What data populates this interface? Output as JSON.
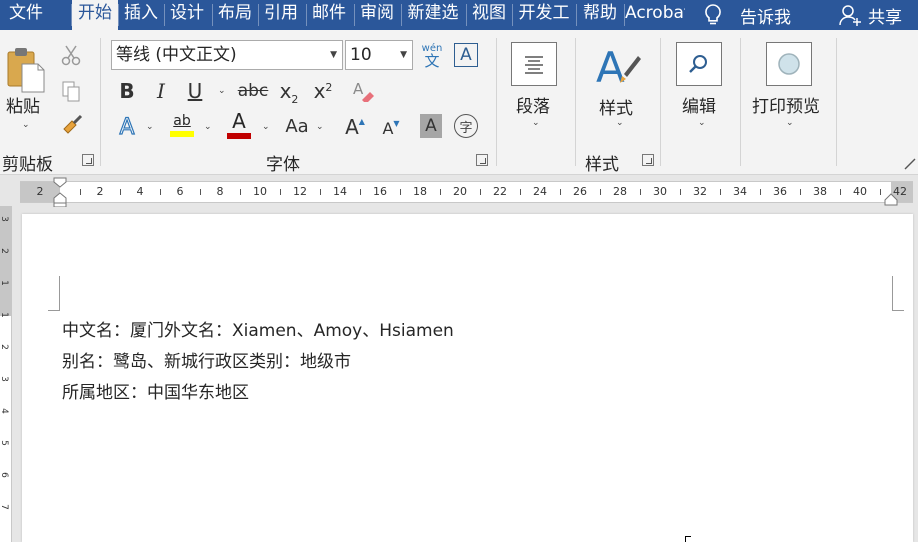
{
  "tabs": [
    "文件",
    "开始",
    "插入",
    "设计",
    "布局",
    "引用",
    "邮件",
    "审阅",
    "新建选",
    "视图",
    "开发工",
    "帮助",
    "Acrobat"
  ],
  "active_tab": "开始",
  "tell_me": "告诉我",
  "share": "共享",
  "clipboard": {
    "paste_label": "粘贴",
    "group_label": "剪贴板"
  },
  "font": {
    "name_value": "等线 (中文正文)",
    "size_value": "10",
    "group_label": "字体",
    "phonetic_top": "wén",
    "phonetic_bottom": "文",
    "border_char": "A",
    "bold": "B",
    "italic": "I",
    "underline": "U",
    "strikethrough": "abc",
    "subscript": "x",
    "subscript_mark": "2",
    "superscript": "x",
    "superscript_mark": "2",
    "change_case": "Aa",
    "grow_font": "A",
    "shrink_font": "A",
    "shading_char": "A",
    "enclose_char": "字",
    "highlight_text": "ab",
    "font_color_char": "A",
    "text_effect_char": "A",
    "highlight_color": "#ffff00",
    "font_color": "#c00000"
  },
  "paragraph": {
    "label": "段落"
  },
  "styles": {
    "label": "样式",
    "group_label": "样式"
  },
  "editing": {
    "label": "编辑"
  },
  "print_preview": {
    "label": "打印预览"
  },
  "ruler_ticks": [
    "2",
    "2",
    "4",
    "6",
    "8",
    "10",
    "12",
    "14",
    "16",
    "18",
    "20",
    "22",
    "24",
    "26",
    "28",
    "30",
    "32",
    "34",
    "36",
    "38",
    "40",
    "42"
  ],
  "vruler_ticks": [
    "3",
    "2",
    "1",
    "1",
    "2",
    "3",
    "4",
    "5",
    "6",
    "7"
  ],
  "document": {
    "lines": [
      "中文名：厦门外文名：Xiamen、Amoy、Hsiamen",
      "别名：鹭岛、新城行政区类别：地级市",
      "所属地区：中国华东地区"
    ]
  },
  "colors": {
    "word_blue": "#2b579a",
    "ribbon_bg": "#f3f3f3",
    "accent_blue": "#2e75b6"
  }
}
